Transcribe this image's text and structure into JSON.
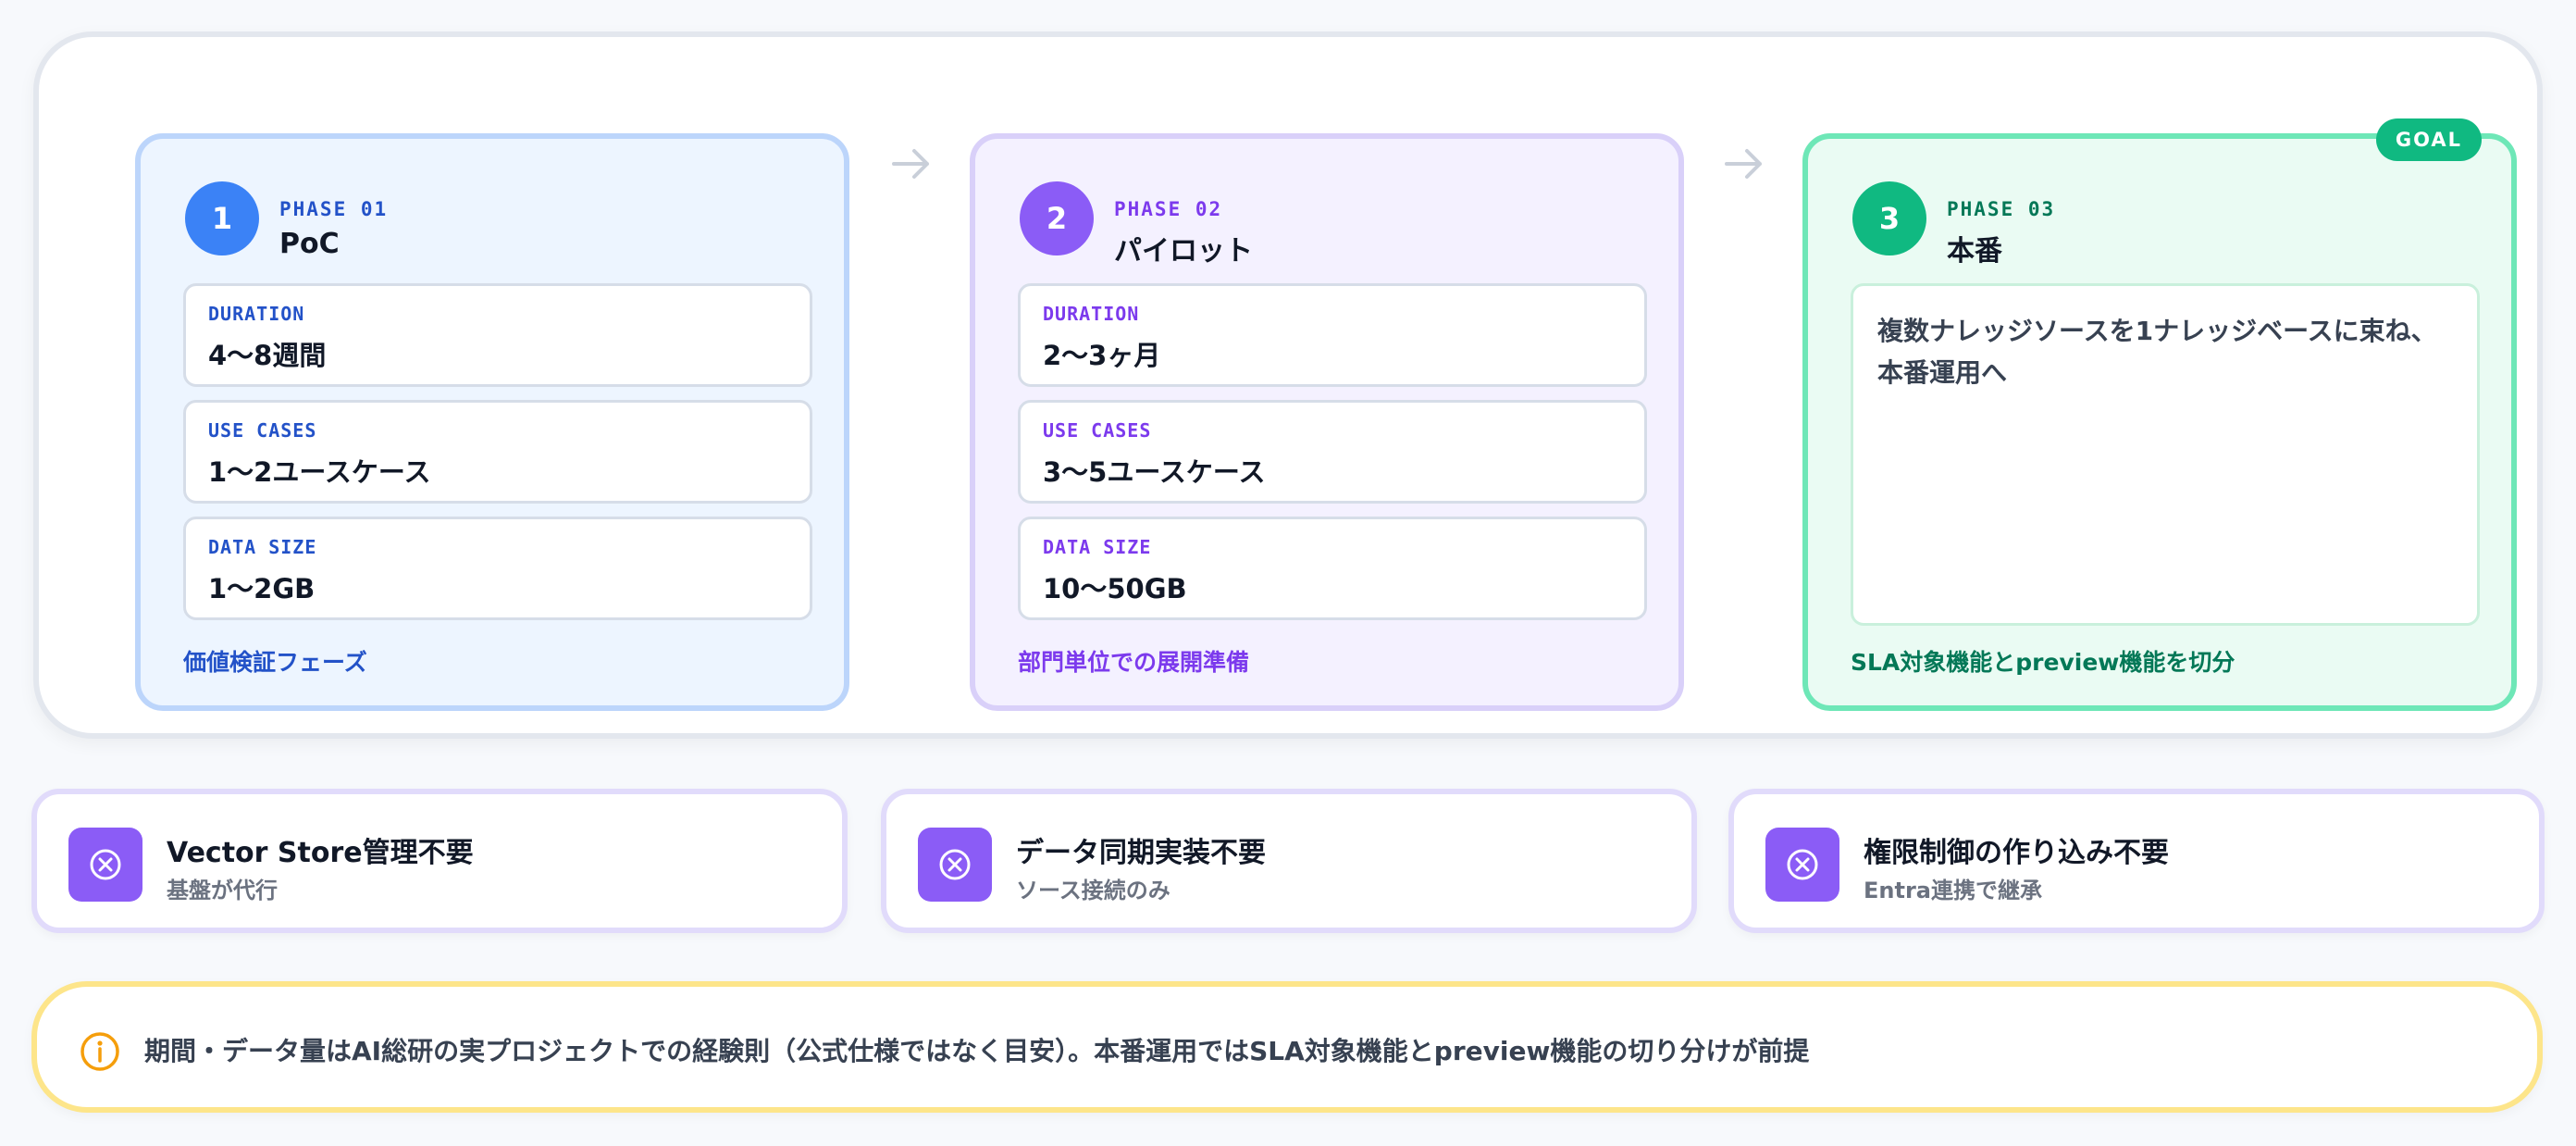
{
  "phases": [
    {
      "number": "1",
      "label": "PHASE 01",
      "name": "PoC",
      "stats": [
        {
          "label": "DURATION",
          "value": "4〜8週間"
        },
        {
          "label": "USE CASES",
          "value": "1〜2ユースケース"
        },
        {
          "label": "DATA SIZE",
          "value": "1〜2GB"
        }
      ],
      "footnote": "価値検証フェーズ"
    },
    {
      "number": "2",
      "label": "PHASE 02",
      "name": "パイロット",
      "stats": [
        {
          "label": "DURATION",
          "value": "2〜3ヶ月"
        },
        {
          "label": "USE CASES",
          "value": "3〜5ユースケース"
        },
        {
          "label": "DATA SIZE",
          "value": "10〜50GB"
        }
      ],
      "footnote": "部門単位での展開準備"
    },
    {
      "number": "3",
      "label": "PHASE 03",
      "name": "本番",
      "description_line1": "複数ナレッジソースを1ナレッジベースに束ね、",
      "description_line2": "本番運用へ",
      "footnote": "SLA対象機能とpreview機能を切分",
      "badge": "GOAL"
    }
  ],
  "benefits": [
    {
      "title": "Vector Store管理不要",
      "sub": "基盤が代行",
      "icon": "x-circle-icon"
    },
    {
      "title": "データ同期実装不要",
      "sub": "ソース接続のみ",
      "icon": "x-circle-icon"
    },
    {
      "title": "権限制御の作り込み不要",
      "sub": "Entra連携で継承",
      "icon": "x-circle-icon"
    }
  ],
  "note": {
    "icon": "info-icon",
    "text": "期間・データ量はAI総研の実プロジェクトでの経験則（公式仕様ではなく目安）。本番運用ではSLA対象機能とpreview機能の切り分けが前提"
  },
  "colors": {
    "phase1": "#3b82f6",
    "phase2": "#8b5cf6",
    "phase3": "#10b981",
    "benefit_icon": "#8b5cf6",
    "note_border": "#fde58a",
    "note_icon": "#f59e0b"
  }
}
